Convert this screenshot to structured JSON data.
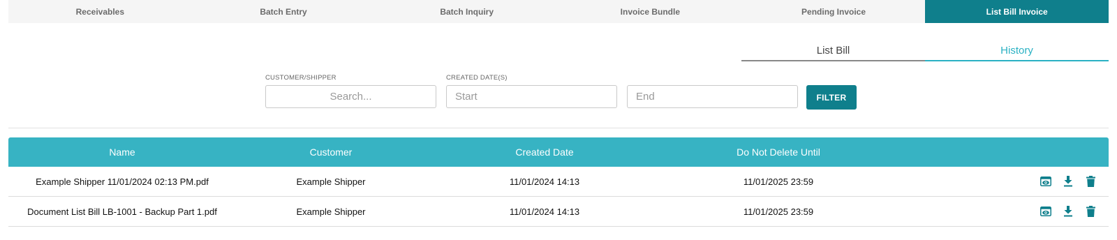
{
  "topnav": {
    "tabs": [
      {
        "label": "Receivables",
        "active": false
      },
      {
        "label": "Batch Entry",
        "active": false
      },
      {
        "label": "Batch Inquiry",
        "active": false
      },
      {
        "label": "Invoice Bundle",
        "active": false
      },
      {
        "label": "Pending Invoice",
        "active": false
      },
      {
        "label": "List Bill Invoice",
        "active": true
      }
    ]
  },
  "subtabs": {
    "list_bill": "List Bill",
    "history": "History",
    "active": "History"
  },
  "filters": {
    "customer_label": "CUSTOMER/SHIPPER",
    "customer_placeholder": "Search...",
    "customer_value": "",
    "created_label": "CREATED DATE(S)",
    "start_placeholder": "Start",
    "start_value": "",
    "end_placeholder": "End",
    "end_value": "",
    "filter_button": "FILTER"
  },
  "table": {
    "columns": [
      "Name",
      "Customer",
      "Created Date",
      "Do Not Delete Until"
    ],
    "rows": [
      {
        "name": "Example Shipper 11/01/2024 02:13 PM.pdf",
        "customer": "Example Shipper",
        "created": "11/01/2024 14:13",
        "do_not_delete": "11/01/2025 23:59"
      },
      {
        "name": "Document List Bill LB-1001 - Backup Part 1.pdf",
        "customer": "Example Shipper",
        "created": "11/01/2024 14:13",
        "do_not_delete": "11/01/2025 23:59"
      }
    ],
    "row_actions": [
      "view-icon",
      "download-icon",
      "trash-icon"
    ]
  },
  "colors": {
    "primary_dark": "#0f7f8c",
    "primary_light": "#37b3c3",
    "active_subtab": "#2ab1c3"
  }
}
